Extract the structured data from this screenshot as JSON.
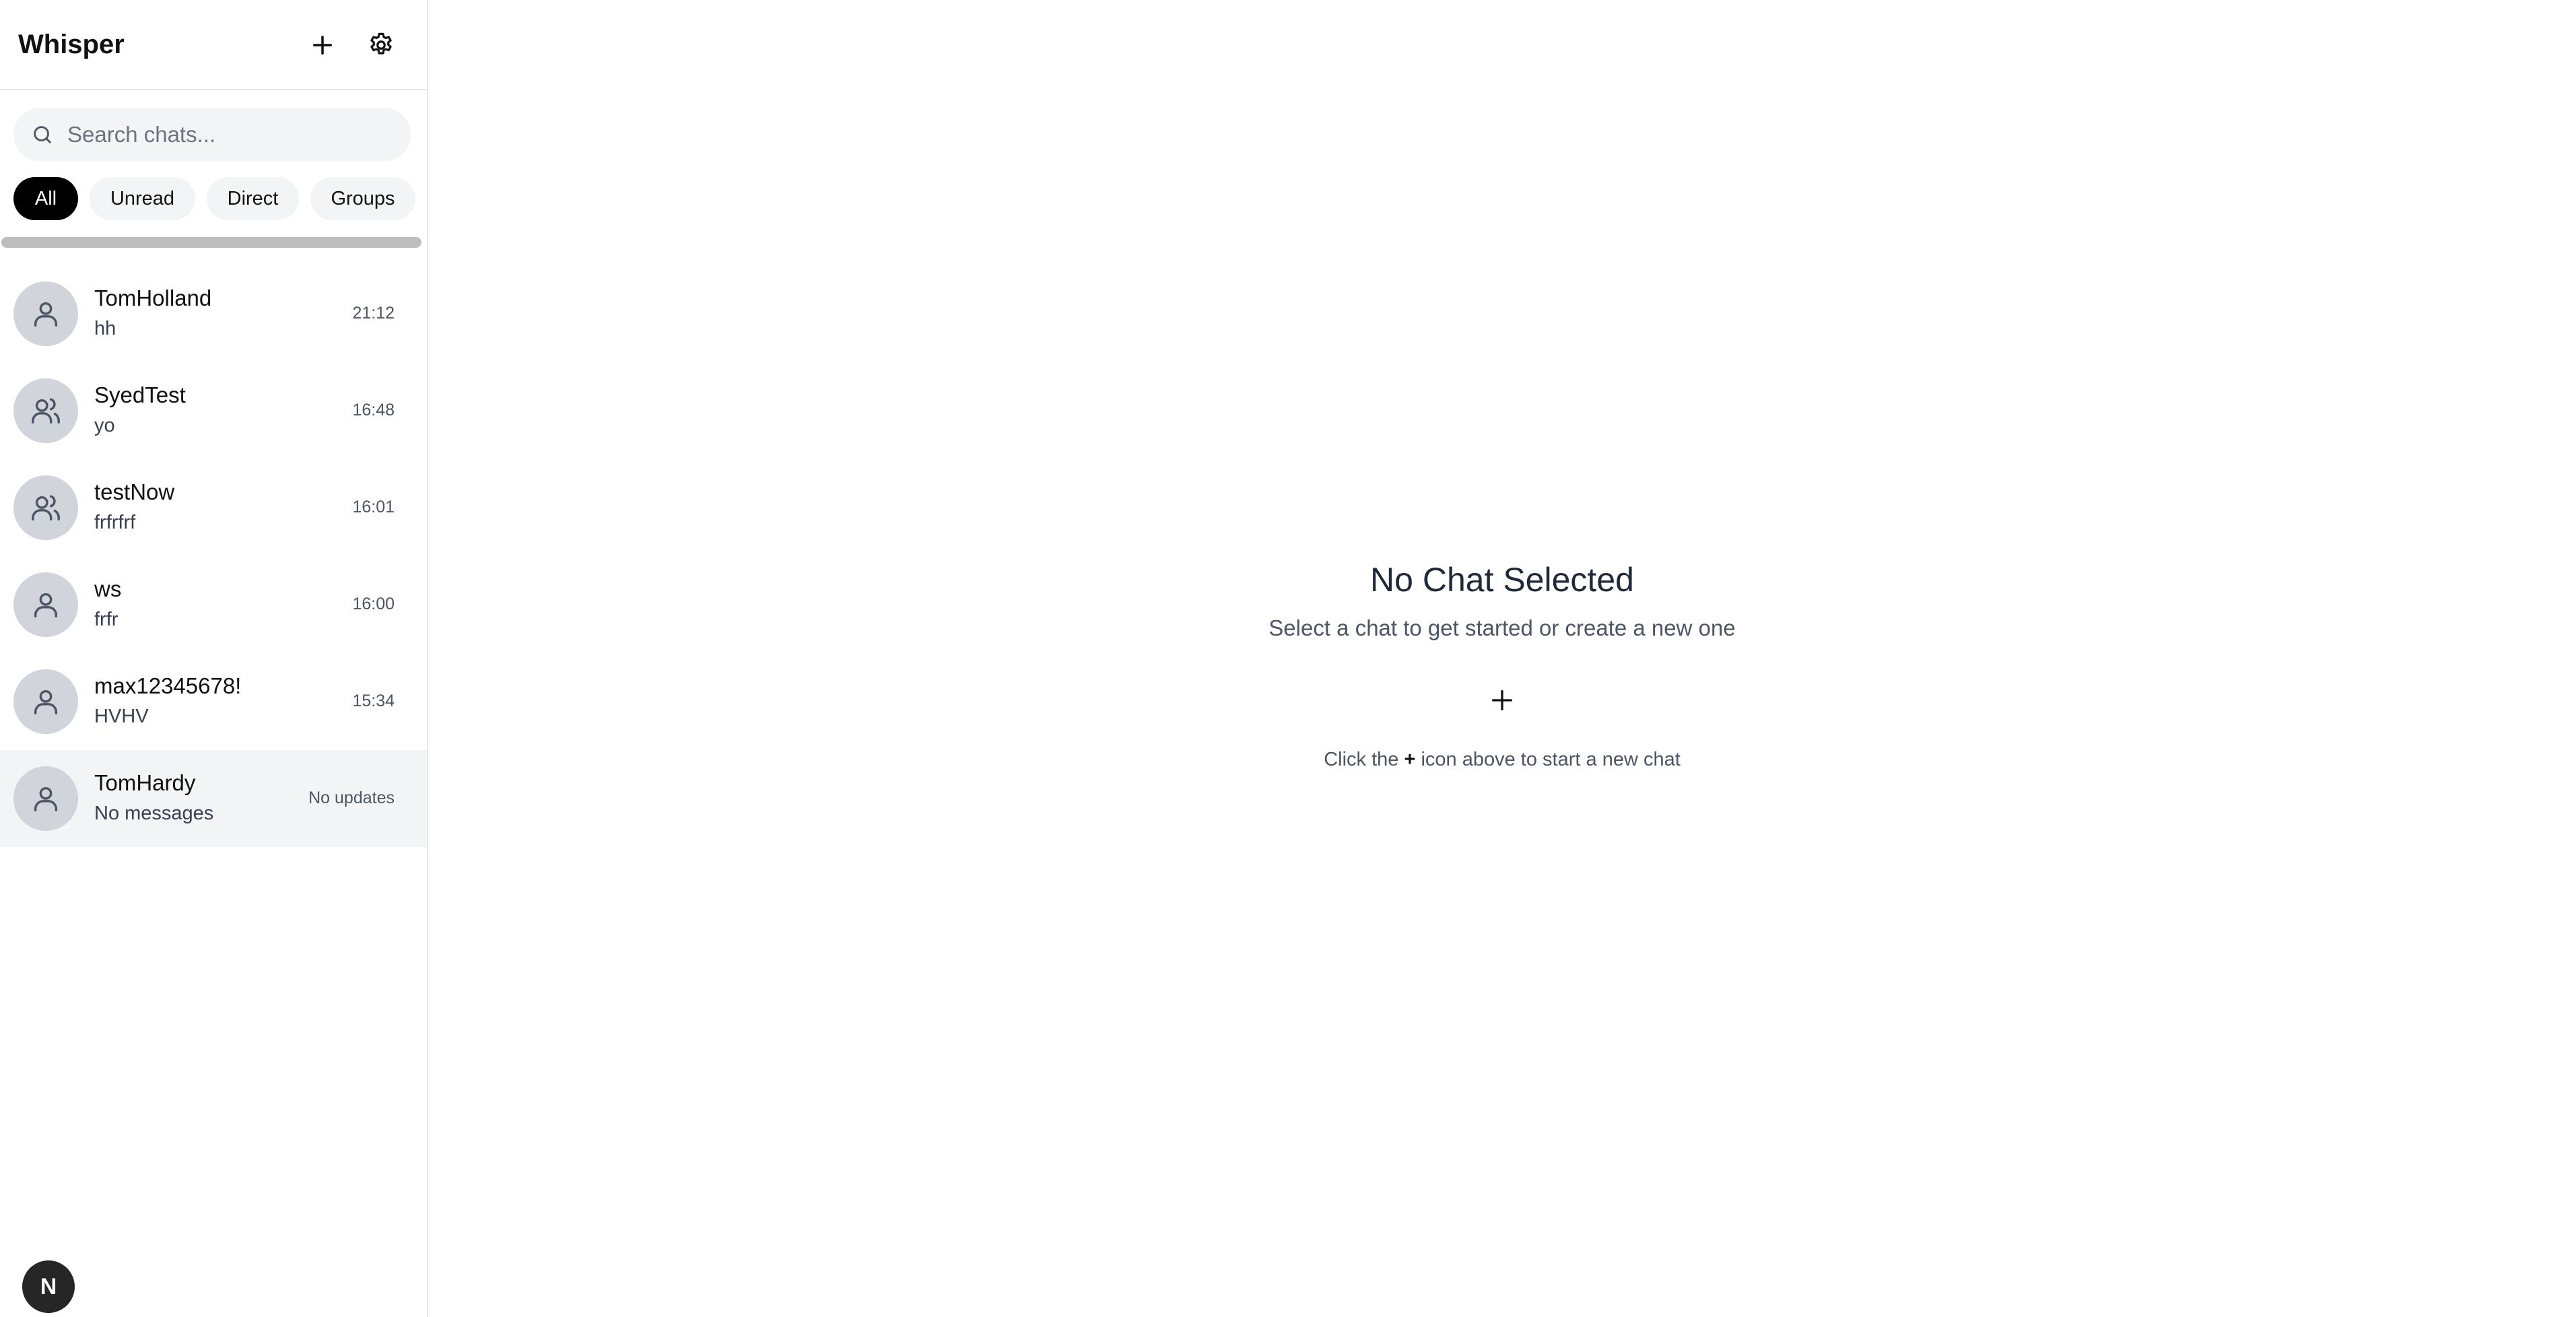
{
  "sidebar": {
    "title": "Whisper",
    "new_chat_icon": "plus-icon",
    "settings_icon": "gear-icon",
    "search": {
      "placeholder": "Search chats...",
      "value": ""
    },
    "filters": [
      {
        "label": "All",
        "active": true
      },
      {
        "label": "Unread",
        "active": false
      },
      {
        "label": "Direct",
        "active": false
      },
      {
        "label": "Groups",
        "active": false
      }
    ],
    "chats": [
      {
        "name": "TomHolland",
        "preview": "hh",
        "time": "21:12",
        "type": "direct",
        "icon": "user-icon"
      },
      {
        "name": "SyedTest",
        "preview": "yo",
        "time": "16:48",
        "type": "group",
        "icon": "users-icon"
      },
      {
        "name": "testNow",
        "preview": "frfrfrf",
        "time": "16:01",
        "type": "group",
        "icon": "users-icon"
      },
      {
        "name": "ws",
        "preview": "frfr",
        "time": "16:00",
        "type": "direct",
        "icon": "user-icon"
      },
      {
        "name": "max12345678!",
        "preview": "HVHV",
        "time": "15:34",
        "type": "direct",
        "icon": "user-icon"
      },
      {
        "name": "TomHardy",
        "preview": "No messages",
        "time": "No updates",
        "type": "direct",
        "icon": "user-icon",
        "selected": true
      }
    ],
    "bottom_badge": "N"
  },
  "main": {
    "empty_title": "No Chat Selected",
    "empty_subtitle": "Select a chat to get started or create a new one",
    "hint_prefix": "Click the",
    "hint_symbol": "+",
    "hint_suffix": "icon above to start a new chat"
  },
  "colors": {
    "active_chip": "#000000",
    "chip_bg": "#f3f4f6",
    "avatar_bg": "#d1d5db",
    "selected_row": "#f3f4f6",
    "divider": "#e5e7eb"
  }
}
